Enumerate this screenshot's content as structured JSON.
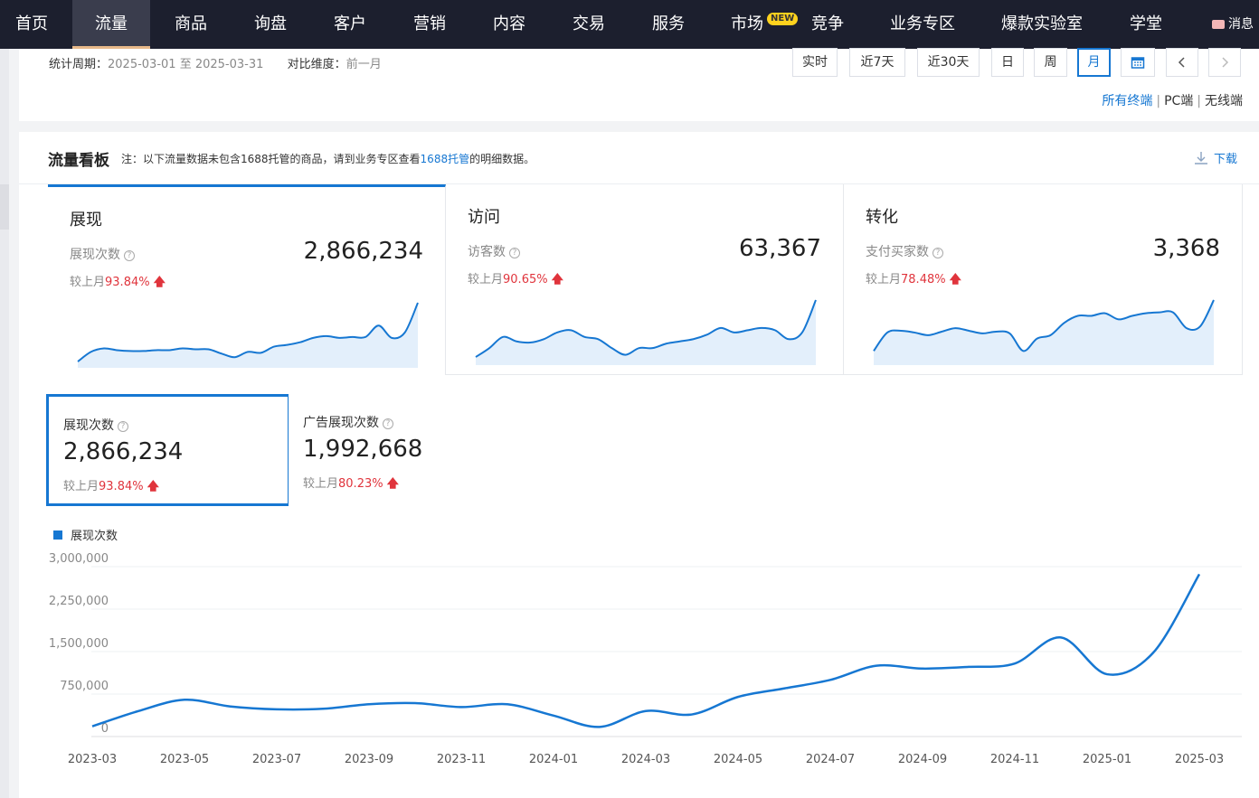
{
  "nav": {
    "items": [
      "首页",
      "流量",
      "商品",
      "询盘",
      "客户",
      "营销",
      "内容",
      "交易",
      "服务",
      "市场",
      "竞争",
      "业务专区",
      "爆款实验室",
      "学堂"
    ],
    "active": "流量",
    "new_badge": "NEW",
    "message_label": "消息"
  },
  "filter": {
    "period_label": "统计周期：",
    "period_value": "2025-03-01 至 2025-03-31",
    "compare_label": "对比维度：",
    "compare_value": "前一月",
    "time_buttons": [
      "实时",
      "近7天",
      "近30天",
      "日",
      "周",
      "月"
    ],
    "selected_time": "月",
    "terminals": [
      "所有终端",
      "PC端",
      "无线端"
    ],
    "selected_terminal": "所有终端"
  },
  "board": {
    "title": "流量看板",
    "note_prefix": "注：以下流量数据未包含1688托管的商品，请到业务专区查看",
    "note_link": "1688托管",
    "note_suffix": "的明细数据。",
    "download_label": "下载"
  },
  "tabs": [
    {
      "name": "展现",
      "metric": "展现次数",
      "value": "2,866,234",
      "compare_label": "较上月",
      "compare_value": "93.84%",
      "spark": [
        3,
        14,
        18,
        16,
        15,
        15,
        16,
        16,
        18,
        17,
        17,
        12,
        8,
        14,
        13,
        20,
        22,
        25,
        30,
        32,
        30,
        31,
        31,
        44,
        30,
        36,
        70
      ]
    },
    {
      "name": "访问",
      "metric": "访客数",
      "value": "63,367",
      "compare_label": "较上月",
      "compare_value": "90.65%",
      "spark": [
        4,
        12,
        22,
        18,
        17,
        20,
        26,
        28,
        22,
        20,
        12,
        6,
        12,
        12,
        16,
        18,
        20,
        24,
        30,
        26,
        28,
        30,
        28,
        20,
        26,
        55
      ]
    },
    {
      "name": "转化",
      "metric": "支付买家数",
      "value": "3,368",
      "compare_label": "较上月",
      "compare_value": "78.48%",
      "spark": [
        12,
        33,
        35,
        33,
        30,
        34,
        38,
        35,
        32,
        34,
        32,
        12,
        26,
        30,
        44,
        52,
        52,
        55,
        48,
        52,
        55,
        56,
        56,
        38,
        40,
        70
      ]
    }
  ],
  "metric_cards": [
    {
      "label": "展现次数",
      "value": "2,866,234",
      "compare_label": "较上月",
      "compare_value": "93.84%"
    },
    {
      "label": "广告展现次数",
      "value": "1,992,668",
      "compare_label": "较上月",
      "compare_value": "80.23%"
    }
  ],
  "chart_data": {
    "type": "line",
    "series": [
      {
        "name": "展现次数",
        "color": "#1677d2"
      }
    ],
    "x": [
      "2023-03",
      "2023-04",
      "2023-05",
      "2023-06",
      "2023-07",
      "2023-08",
      "2023-09",
      "2023-10",
      "2023-11",
      "2023-12",
      "2024-01",
      "2024-02",
      "2024-03",
      "2024-04",
      "2024-05",
      "2024-06",
      "2024-07",
      "2024-08",
      "2024-09",
      "2024-10",
      "2024-11",
      "2024-12",
      "2025-01",
      "2025-02",
      "2025-03"
    ],
    "values": [
      180000,
      450000,
      650000,
      530000,
      480000,
      490000,
      570000,
      590000,
      520000,
      570000,
      370000,
      170000,
      450000,
      390000,
      700000,
      850000,
      1000000,
      1250000,
      1200000,
      1230000,
      1290000,
      1750000,
      1100000,
      1480000,
      2866234
    ],
    "xtick_labels": [
      "2023-03",
      "2023-05",
      "2023-07",
      "2023-09",
      "2023-11",
      "2024-01",
      "2024-03",
      "2024-05",
      "2024-07",
      "2024-09",
      "2024-11",
      "2025-01",
      "2025-03"
    ],
    "ytick_labels": [
      "0",
      "750,000",
      "1,500,000",
      "2,250,000",
      "3,000,000"
    ],
    "ylim": [
      0,
      3000000
    ],
    "grid": true,
    "legend": "top-left"
  }
}
